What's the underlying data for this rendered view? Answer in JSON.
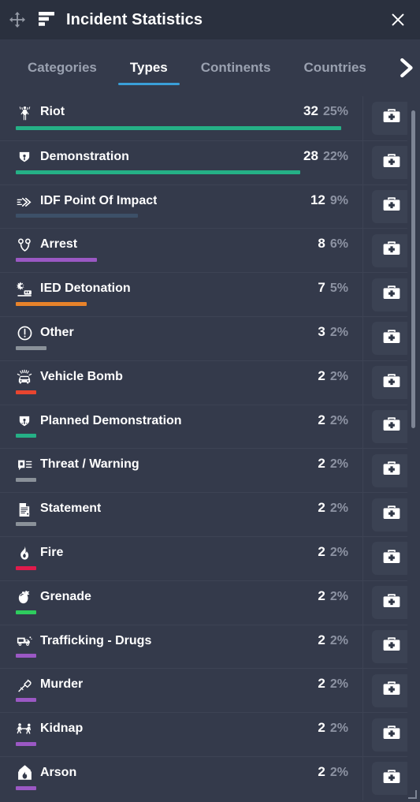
{
  "window": {
    "title": "Incident Statistics",
    "move_icon": "move-icon",
    "title_icon": "bar-chart-icon",
    "close_icon": "close-icon"
  },
  "tabs": {
    "items": [
      {
        "label": "Categories",
        "active": false
      },
      {
        "label": "Types",
        "active": true
      },
      {
        "label": "Continents",
        "active": false
      },
      {
        "label": "Countries",
        "active": false
      }
    ],
    "next_icon": "chevron-right-icon",
    "active_underline_color": "#3a9fd8"
  },
  "list": {
    "action_icon": "medical-kit-icon",
    "rows": [
      {
        "icon": "riot-icon",
        "label": "Riot",
        "count": "32",
        "percent": "25%",
        "bar_ratio": 1.0,
        "bar_color": "#25b086"
      },
      {
        "icon": "demonstration-icon",
        "label": "Demonstration",
        "count": "28",
        "percent": "22%",
        "bar_ratio": 0.875,
        "bar_color": "#25b086"
      },
      {
        "icon": "idf-point-of-impact-icon",
        "label": "IDF Point Of Impact",
        "count": "12",
        "percent": "9%",
        "bar_ratio": 0.375,
        "bar_color": "#3d5068"
      },
      {
        "icon": "arrest-icon",
        "label": "Arrest",
        "count": "8",
        "percent": "6%",
        "bar_ratio": 0.25,
        "bar_color": "#9b58c4"
      },
      {
        "icon": "ied-detonation-icon",
        "label": "IED Detonation",
        "count": "7",
        "percent": "5%",
        "bar_ratio": 0.219,
        "bar_color": "#e8832a"
      },
      {
        "icon": "other-icon",
        "label": "Other",
        "count": "3",
        "percent": "2%",
        "bar_ratio": 0.094,
        "bar_color": "#8a9199"
      },
      {
        "icon": "vehicle-bomb-icon",
        "label": "Vehicle Bomb",
        "count": "2",
        "percent": "2%",
        "bar_ratio": 0.0625,
        "bar_color": "#e8452f"
      },
      {
        "icon": "planned-demonstration-icon",
        "label": "Planned Demonstration",
        "count": "2",
        "percent": "2%",
        "bar_ratio": 0.0625,
        "bar_color": "#25b086"
      },
      {
        "icon": "threat-warning-icon",
        "label": "Threat / Warning",
        "count": "2",
        "percent": "2%",
        "bar_ratio": 0.0625,
        "bar_color": "#8a9199"
      },
      {
        "icon": "statement-icon",
        "label": "Statement",
        "count": "2",
        "percent": "2%",
        "bar_ratio": 0.0625,
        "bar_color": "#8a9199"
      },
      {
        "icon": "fire-icon",
        "label": "Fire",
        "count": "2",
        "percent": "2%",
        "bar_ratio": 0.0625,
        "bar_color": "#e01b4c"
      },
      {
        "icon": "grenade-icon",
        "label": "Grenade",
        "count": "2",
        "percent": "2%",
        "bar_ratio": 0.0625,
        "bar_color": "#2ecc5e"
      },
      {
        "icon": "trafficking-drugs-icon",
        "label": "Trafficking - Drugs",
        "count": "2",
        "percent": "2%",
        "bar_ratio": 0.0625,
        "bar_color": "#9b58c4"
      },
      {
        "icon": "murder-icon",
        "label": "Murder",
        "count": "2",
        "percent": "2%",
        "bar_ratio": 0.0625,
        "bar_color": "#9b58c4"
      },
      {
        "icon": "kidnap-icon",
        "label": "Kidnap",
        "count": "2",
        "percent": "2%",
        "bar_ratio": 0.0625,
        "bar_color": "#9b58c4"
      },
      {
        "icon": "arson-icon",
        "label": "Arson",
        "count": "2",
        "percent": "2%",
        "bar_ratio": 0.0625,
        "bar_color": "#9b58c4"
      }
    ]
  },
  "scrollbar": {
    "thumb_top_pct": 2,
    "thumb_height_pct": 45
  },
  "colors": {
    "window_bg": "#343a4b",
    "titlebar_bg": "#2a303e",
    "divider": "#3d4354",
    "text_primary": "#ffffff",
    "text_muted": "#8d93a3",
    "accent": "#3a9fd8",
    "button_bg": "#3b4253"
  }
}
